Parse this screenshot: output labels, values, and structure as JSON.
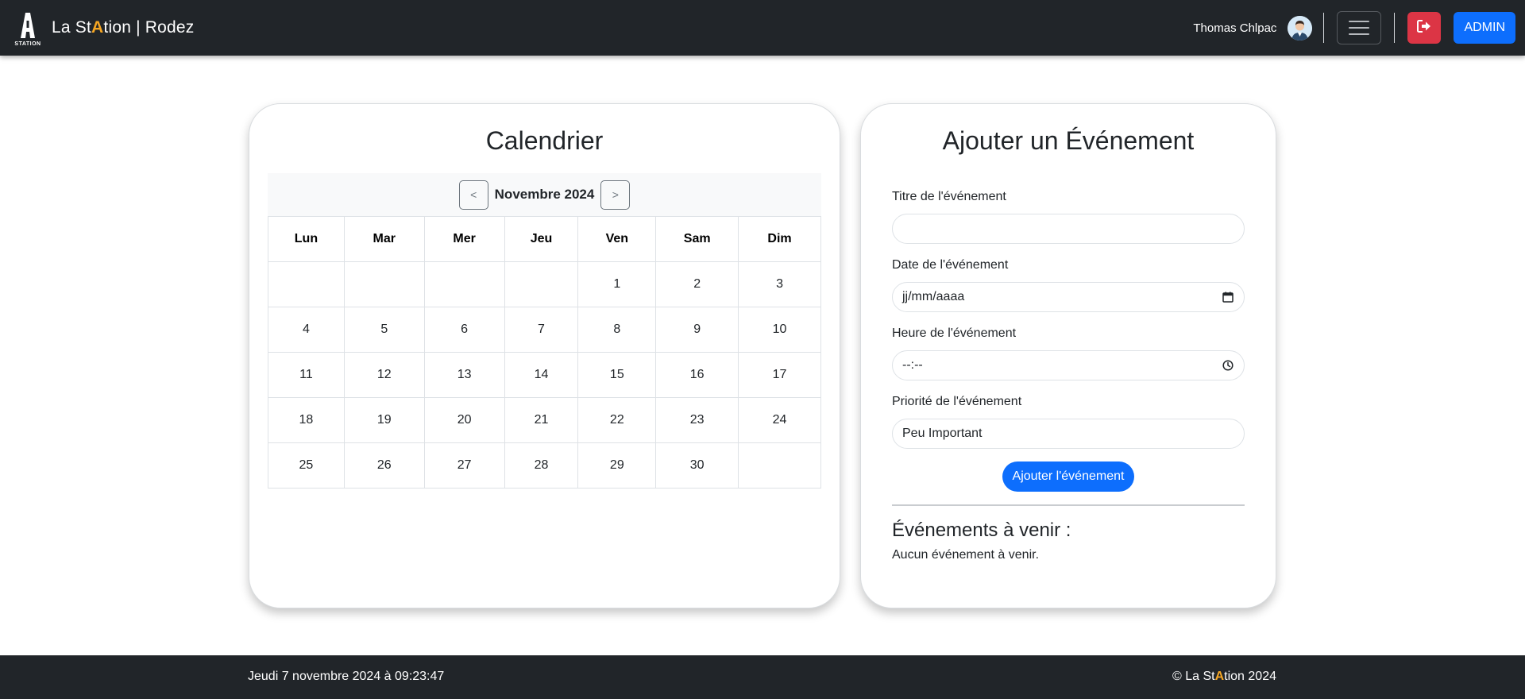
{
  "navbar": {
    "logo_caption": "STATION",
    "brand_prefix": "La St",
    "brand_accent": "A",
    "brand_suffix": "tion | Rodez",
    "accent_color": "#f5a623",
    "user_name": "Thomas Chlpac",
    "avatar_icon": "user-avatar",
    "menu_icon": "hamburger-icon",
    "logout_icon": "logout-icon",
    "logout_color": "#dc3545",
    "admin_label": "ADMIN",
    "admin_color": "#0d6efd"
  },
  "calendar": {
    "title": "Calendrier",
    "prev_label": "<",
    "next_label": ">",
    "month_label": "Novembre 2024",
    "weekdays": [
      "Lun",
      "Mar",
      "Mer",
      "Jeu",
      "Ven",
      "Sam",
      "Dim"
    ],
    "weeks": [
      [
        "",
        "",
        "",
        "",
        "1",
        "2",
        "3"
      ],
      [
        "4",
        "5",
        "6",
        "7",
        "8",
        "9",
        "10"
      ],
      [
        "11",
        "12",
        "13",
        "14",
        "15",
        "16",
        "17"
      ],
      [
        "18",
        "19",
        "20",
        "21",
        "22",
        "23",
        "24"
      ],
      [
        "25",
        "26",
        "27",
        "28",
        "29",
        "30",
        ""
      ]
    ]
  },
  "event_form": {
    "title": "Ajouter un Événement",
    "title_label": "Titre de l'événement",
    "title_value": "",
    "date_label": "Date de l'événement",
    "date_placeholder": "jj/mm/aaaa",
    "time_label": "Heure de l'événement",
    "time_placeholder": "--:--",
    "priority_label": "Priorité de l'événement",
    "priority_value": "Peu Important",
    "submit_label": "Ajouter l'événement",
    "upcoming_title": "Événements à venir :",
    "upcoming_empty": "Aucun événement à venir."
  },
  "footer": {
    "datetime": "Jeudi 7 novembre 2024 à 09:23:47",
    "copyright_prefix": "© La St",
    "copyright_accent": "A",
    "copyright_suffix": "tion 2024"
  }
}
